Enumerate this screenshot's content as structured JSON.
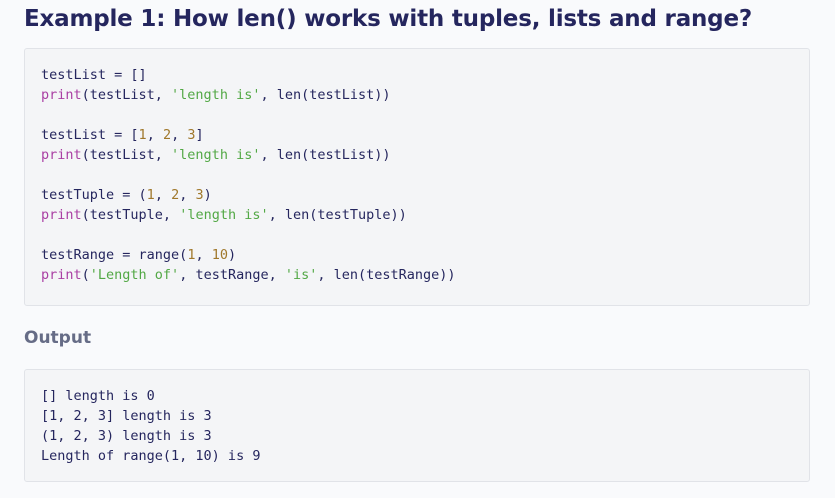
{
  "title": "Example 1: How len() works with tuples, lists and range?",
  "code": {
    "block1": {
      "line1": "testList = []",
      "line2": {
        "fn": "print",
        "a": "(testList, ",
        "s": "'length is'",
        "b": ", len(testList))"
      }
    },
    "block2": {
      "line1": {
        "a": "testList = [",
        "n1": "1",
        "c1": ", ",
        "n2": "2",
        "c2": ", ",
        "n3": "3",
        "b": "]"
      },
      "line2": {
        "fn": "print",
        "a": "(testList, ",
        "s": "'length is'",
        "b": ", len(testList))"
      }
    },
    "block3": {
      "line1": {
        "a": "testTuple = (",
        "n1": "1",
        "c1": ", ",
        "n2": "2",
        "c2": ", ",
        "n3": "3",
        "b": ")"
      },
      "line2": {
        "fn": "print",
        "a": "(testTuple, ",
        "s": "'length is'",
        "b": ", len(testTuple))"
      }
    },
    "block4": {
      "line1": {
        "a": "testRange = range(",
        "n1": "1",
        "c1": ", ",
        "n2": "10",
        "b": ")"
      },
      "line2": {
        "fn": "print",
        "a": "(",
        "s1": "'Length of'",
        "c1": ", testRange, ",
        "s2": "'is'",
        "b": ", len(testRange))"
      }
    }
  },
  "output_heading": "Output",
  "output": [
    "[] length is 0",
    "[1, 2, 3] length is 3",
    "(1, 2, 3) length is 3",
    "Length of range(1, 10) is 9"
  ],
  "colors": {
    "title": "#25265e",
    "keyword": "#a93fa3",
    "string": "#52a845",
    "number": "#a0782b",
    "code_bg": "#f4f5f7"
  }
}
